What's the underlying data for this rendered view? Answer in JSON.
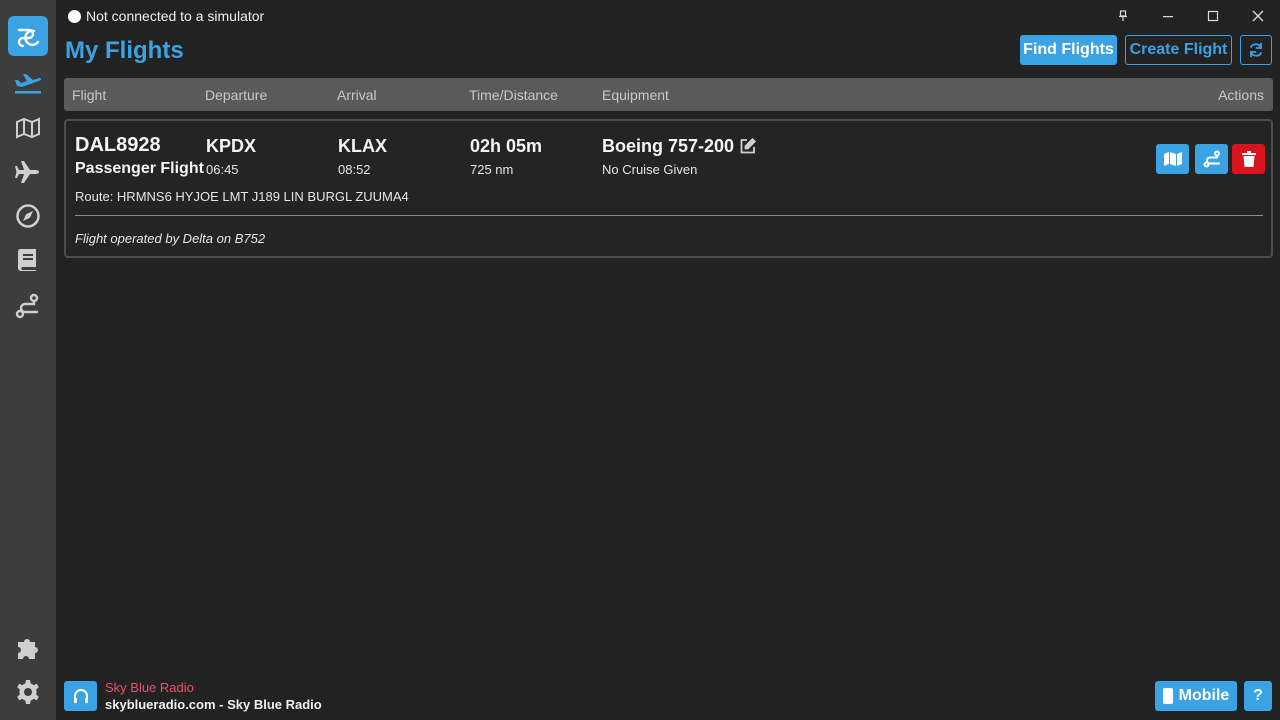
{
  "titlebar": {
    "status_text": "Not connected to a simulator",
    "pin_icon": "pin-icon",
    "minimize_icon": "minimize-icon",
    "maximize_icon": "maximize-icon",
    "close_icon": "close-icon"
  },
  "sidebar": {
    "items": [
      {
        "name": "app-logo-icon"
      },
      {
        "name": "my-flights-icon"
      },
      {
        "name": "map-icon"
      },
      {
        "name": "airplane-icon"
      },
      {
        "name": "compass-icon"
      },
      {
        "name": "logbook-icon"
      },
      {
        "name": "route-icon"
      },
      {
        "name": "puzzle-icon"
      },
      {
        "name": "gear-icon"
      }
    ]
  },
  "header": {
    "title": "My Flights",
    "find_label": "Find Flights",
    "create_label": "Create Flight",
    "refresh_icon": "refresh-icon"
  },
  "table": {
    "columns": [
      "Flight",
      "Departure",
      "Arrival",
      "Time/Distance",
      "Equipment",
      "Actions"
    ]
  },
  "flight": {
    "id": "DAL8928",
    "type": "Passenger Flight",
    "departure": "KPDX",
    "departure_time": "06:45",
    "arrival": "KLAX",
    "arrival_time": "08:52",
    "duration": "02h 05m",
    "distance": "725 nm",
    "equipment": "Boeing 757-200",
    "cruise": "No Cruise Given",
    "route": "Route: HRMNS6 HYJOE LMT J189 LIN BURGL ZUUMA4",
    "operator_note": "Flight operated by Delta on B752"
  },
  "footer": {
    "radio_name": "Sky Blue Radio",
    "radio_url": "skyblueradio.com - Sky Blue Radio",
    "mobile_label": "Mobile",
    "help_label": "?"
  },
  "colors": {
    "accent": "#3aa3e3",
    "danger": "#d9141c",
    "radio_name": "#e8536a",
    "background": "#222222",
    "sidebar": "#3d3d3d"
  }
}
